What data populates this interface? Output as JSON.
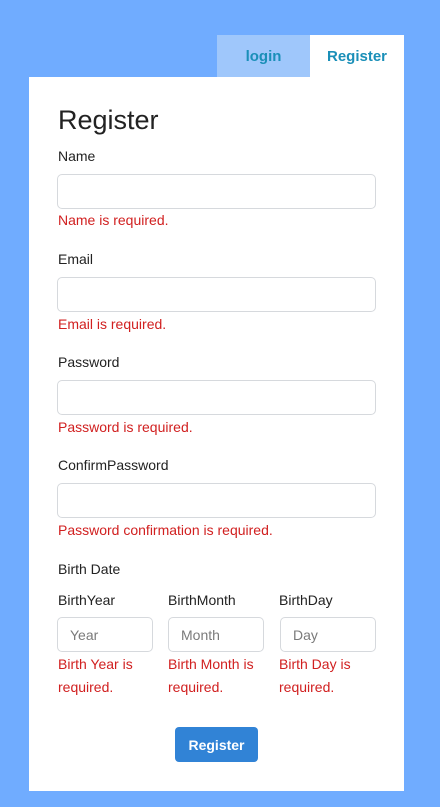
{
  "tabs": {
    "login": "login",
    "register": "Register"
  },
  "form": {
    "title": "Register",
    "name": {
      "label": "Name",
      "error": "Name is required."
    },
    "email": {
      "label": "Email",
      "error": "Email is required."
    },
    "password": {
      "label": "Password",
      "error": "Password is required."
    },
    "confirm": {
      "label": "ConfirmPassword",
      "error": "Password confirmation is required."
    },
    "birth_date_label": "Birth Date",
    "birth_year": {
      "label": "BirthYear",
      "placeholder": "Year",
      "error": "Birth Year is required."
    },
    "birth_month": {
      "label": "BirthMonth",
      "placeholder": "Month",
      "error": "Birth Month is required."
    },
    "birth_day": {
      "label": "BirthDay",
      "placeholder": "Day",
      "error": "Birth Day is required."
    },
    "submit_label": "Register"
  },
  "colors": {
    "background": "#70acff",
    "error": "#d12020",
    "button": "#3183d6",
    "tab_link": "#1a8fb8"
  }
}
